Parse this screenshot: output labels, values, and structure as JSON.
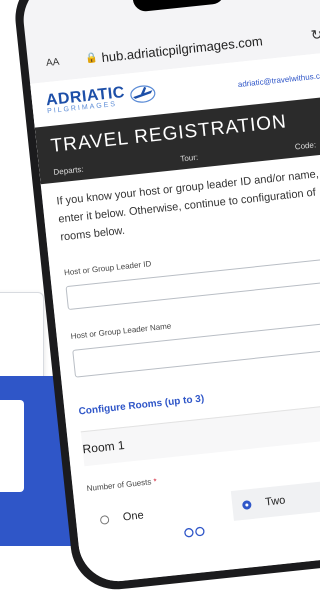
{
  "browser": {
    "text_size_label": "AA",
    "url": "hub.adriaticpilgrimages.com"
  },
  "site": {
    "logo_name": "ADRIATIC",
    "logo_sub": "PILGRIMAGES",
    "contact_email": "adriatic@travelwithus.com"
  },
  "banner": {
    "title": "TRAVEL REGISTRATION",
    "departs_label": "Departs:",
    "tour_label": "Tour:",
    "code_label": "Code:"
  },
  "form": {
    "intro": "If you know your host or group leader ID and/or name, enter it below. Otherwise, continue to configuration of rooms below.",
    "host_id_label": "Host or Group Leader ID",
    "host_name_label": "Host or Group Leader Name",
    "configure_rooms": "Configure Rooms (up to 3)",
    "room_title": "Room 1",
    "guests_label": "Number of Guests",
    "guests_required_mark": "*",
    "guest_options": [
      "One",
      "Two"
    ],
    "selected_guest_option": "Two"
  },
  "colors": {
    "accent": "#2f56c8",
    "banner_bg": "#2b2b2b",
    "required": "#d0142c"
  }
}
